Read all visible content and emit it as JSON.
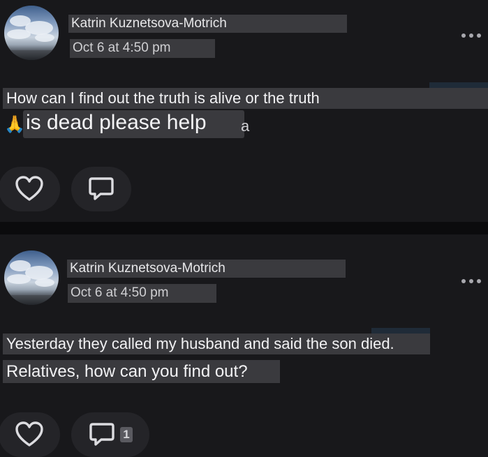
{
  "posts": [
    {
      "author": "Katrin Kuznetsova-Motrich",
      "timestamp": "Oct 6 at 4:50 pm",
      "text_lines": [
        "How can I find out the truth is alive or the truth",
        "is dead please help"
      ],
      "emoji": "🙏",
      "trailing_fragment": "a",
      "more_icon": "more-horizontal-icon",
      "like_icon": "heart-outline-icon",
      "comment_icon": "comment-bubble-icon"
    },
    {
      "author": "Katrin Kuznetsova-Motrich",
      "timestamp": "Oct 6 at 4:50 pm",
      "text_lines": [
        "Yesterday they called my husband and said the son died.",
        "Relatives, how can you find out?"
      ],
      "comment_count": "1",
      "more_icon": "more-horizontal-icon",
      "like_icon": "heart-outline-icon",
      "comment_icon": "comment-bubble-icon"
    }
  ],
  "colors": {
    "background": "#0b0b0d",
    "card": "#18181b",
    "label_box": "#3a3a3e",
    "text": "#f2f2f4",
    "button": "#242428"
  }
}
